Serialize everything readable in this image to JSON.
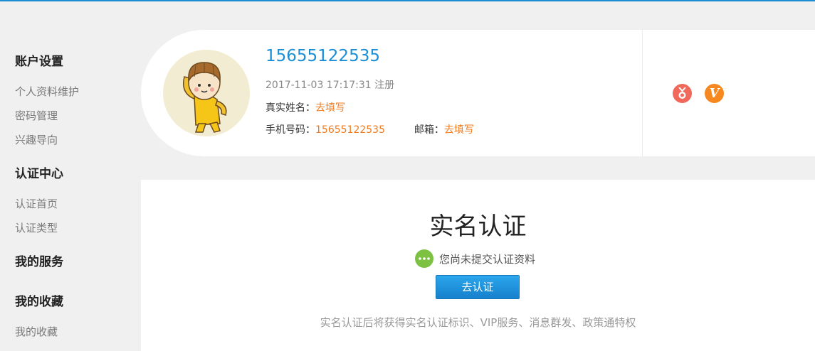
{
  "sidebar": {
    "sections": [
      {
        "heading": "账户设置",
        "items": [
          "个人资料维护",
          "密码管理",
          "兴趣导向"
        ]
      },
      {
        "heading": "认证中心",
        "items": [
          "认证首页",
          "认证类型"
        ]
      },
      {
        "heading": "我的服务",
        "items": []
      },
      {
        "heading": "我的收藏",
        "items": [
          "我的收藏"
        ]
      }
    ]
  },
  "profile": {
    "username": "15655122535",
    "registered_time": "2017-11-03 17:17:31",
    "registered_suffix": "注册",
    "real_name_label": "真实姓名：",
    "real_name_value": "去填写",
    "phone_label": "手机号码：",
    "phone_value": "15655122535",
    "email_label": "邮箱：",
    "email_value": "去填写"
  },
  "badges": {
    "vip_glyph": "V"
  },
  "verification": {
    "title": "实名认证",
    "status": "您尚未提交认证资料",
    "button_label": "去认证",
    "note": "实名认证后将获得实名认证标识、VIP服务、消息群发、政策通特权"
  },
  "colors": {
    "accent_blue": "#1a8fd6",
    "link_orange": "#f07a1e",
    "status_green": "#7cc142",
    "medal_red": "#f0695a",
    "vip_orange": "#f7881f"
  }
}
